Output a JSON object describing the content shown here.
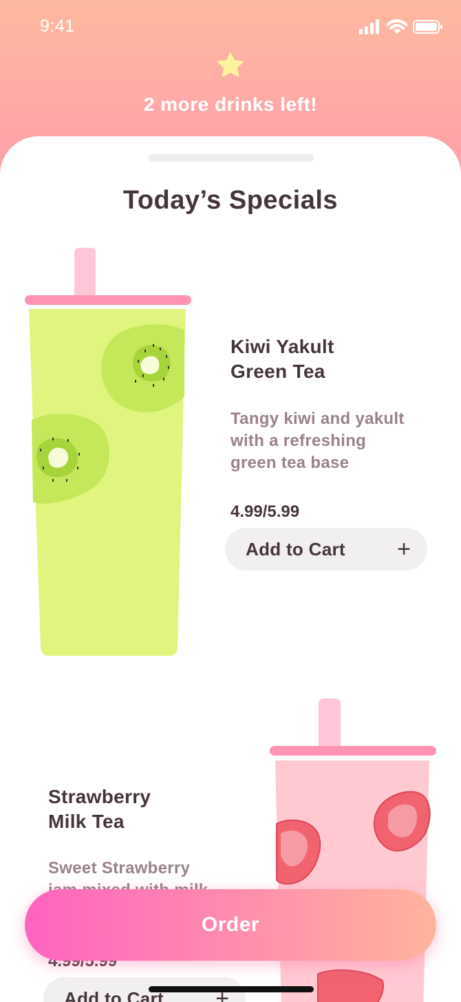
{
  "status_bar": {
    "time": "9:41"
  },
  "header": {
    "message": "2 more drinks left!"
  },
  "section_title": "Today’s Specials",
  "products": [
    {
      "name_line1": "Kiwi Yakult",
      "name_line2": "Green Tea",
      "desc_lines": [
        "Tangy kiwi and yakult",
        "with a refreshing",
        "green tea base"
      ],
      "price": "4.99/5.99",
      "cart_label": "Add to Cart",
      "cart_symbol": "+"
    },
    {
      "name_line1": "Strawberry",
      "name_line2": "Milk Tea",
      "desc_lines": [
        "Sweet Strawberry",
        "jam mixed with milk"
      ],
      "price": "4.99/5.99",
      "cart_label": "Add to Cart",
      "cart_symbol": "+"
    }
  ],
  "order_button": {
    "label": "Order"
  },
  "colors": {
    "header_top": "#ffb9a0",
    "header_bottom": "#ff9fab",
    "order_gradient_start": "#ff63c0",
    "order_gradient_end": "#ffb49c",
    "kiwi_cup": "#e0f57e",
    "strawberry_cup": "#ffc9d1",
    "straw": "#ffc6d8",
    "lid": "#ff93b4"
  }
}
